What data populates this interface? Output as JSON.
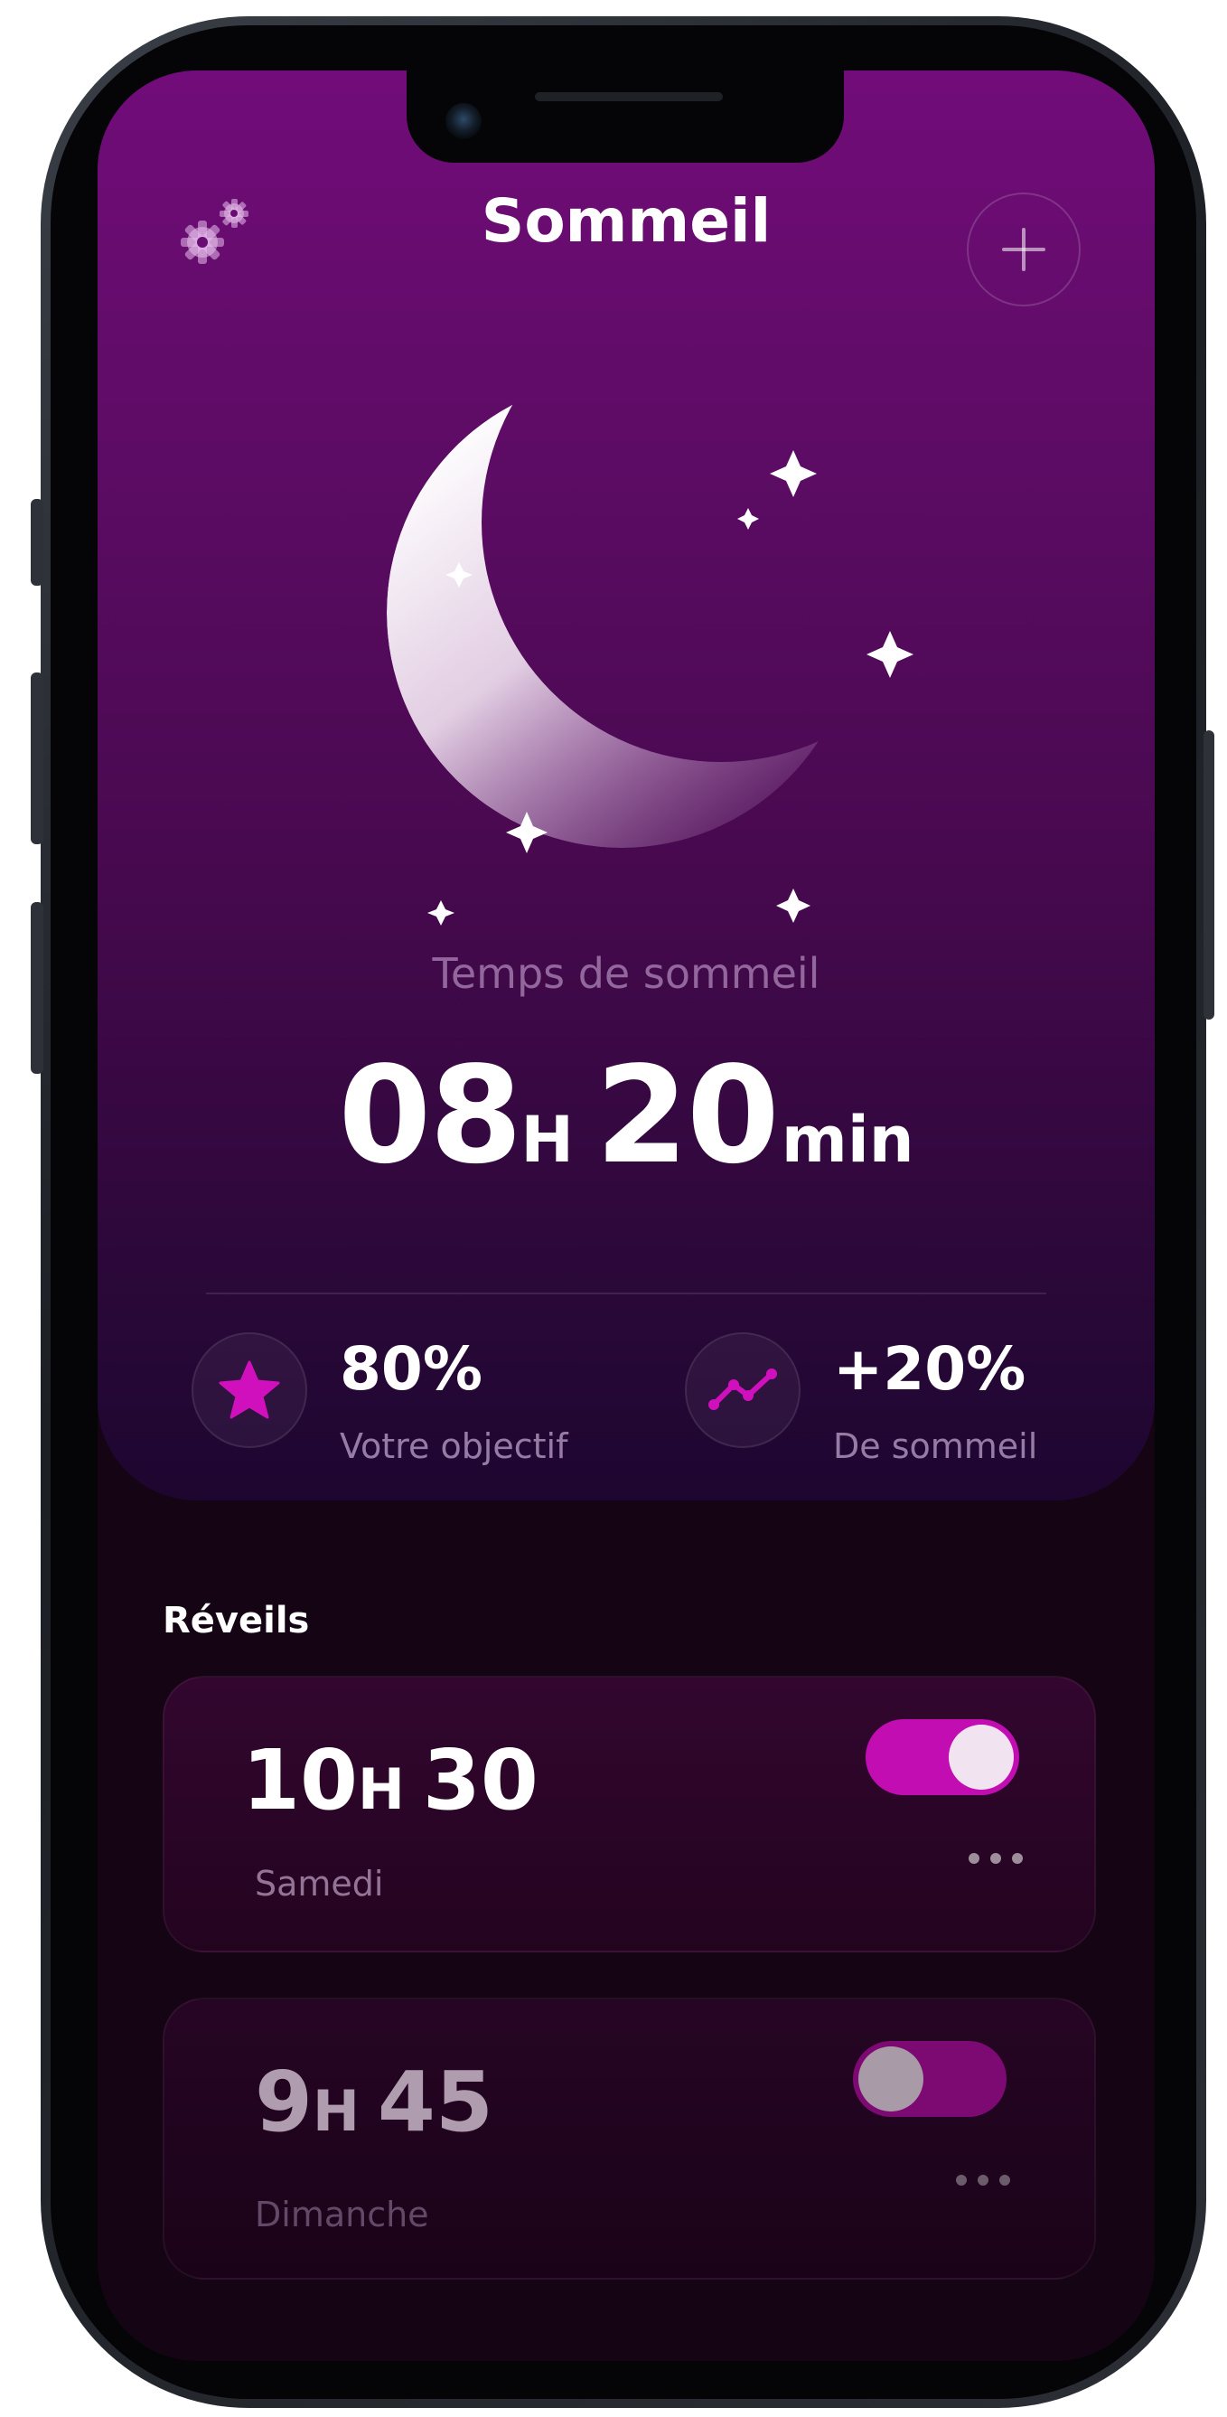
{
  "header": {
    "title": "Sommeil"
  },
  "sleep": {
    "label": "Temps de sommeil",
    "hours": "08",
    "hours_unit": "H",
    "minutes": "20",
    "minutes_unit": "min"
  },
  "stats": [
    {
      "value": "80%",
      "caption": "Votre objectif",
      "icon": "star-icon"
    },
    {
      "value": "+20%",
      "caption": "De sommeil",
      "icon": "trend-line-icon"
    }
  ],
  "alarms_section": {
    "title": "Réveils"
  },
  "alarms": [
    {
      "hours": "10",
      "hours_unit": "H",
      "minutes": "30",
      "day": "Samedi",
      "enabled": true
    },
    {
      "hours": "9",
      "hours_unit": "H",
      "minutes": "45",
      "day": "Dimanche",
      "enabled": false
    }
  ],
  "colors": {
    "accent": "#c60eb4",
    "hero_top": "#720c7a",
    "hero_bottom": "#1d0630",
    "background": "#140312"
  }
}
